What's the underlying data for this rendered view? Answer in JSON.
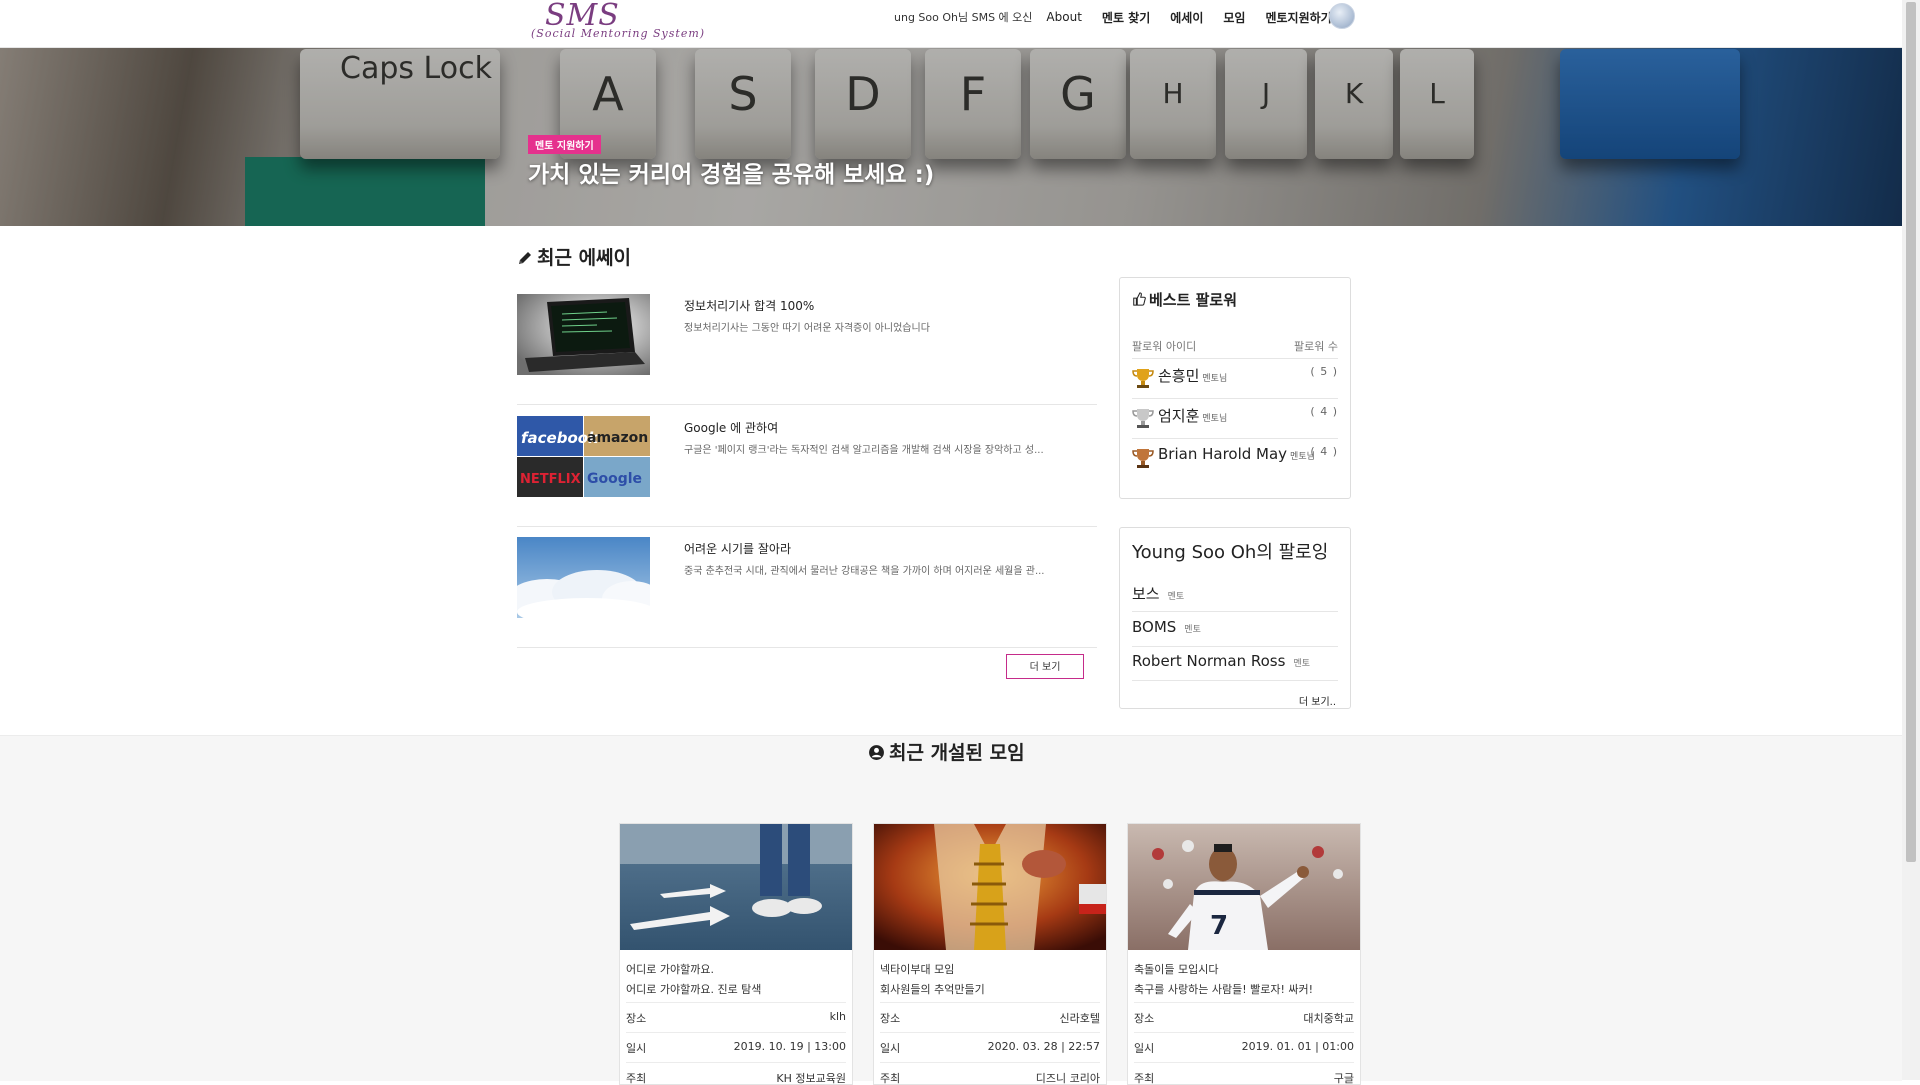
{
  "brand": {
    "name": "SMS",
    "subtitle": "(Social Mentoring System)"
  },
  "nav": {
    "welcome": "ung Soo Oh님 SMS 에 오신",
    "links": [
      "About",
      "멘토 찾기",
      "에세이",
      "모임",
      "멘토지원하기"
    ]
  },
  "hero": {
    "badge": "멘토 지원하기",
    "title": "가치 있는 커리어 경험을 공유해 보세요 :)",
    "keys": [
      "Caps Lock",
      "A",
      "S",
      "D",
      "F",
      "G",
      "H",
      "J",
      "K",
      "L"
    ]
  },
  "essays": {
    "title": "최근 에쎄이",
    "items": [
      {
        "title": "정보처리기사 합격 100%",
        "desc": "정보처리기사는 그동안 따기 어려운 자격증이 아니었습니다"
      },
      {
        "title": "Google 에 관하여",
        "desc": "구글은 '페이지 랭크'라는 독자적인 검색 알고리즘을 개발해 검색 시장을 장악하고 성..."
      },
      {
        "title": "어려운 시기를 잘아라",
        "desc": "중국 춘추전국 시대, 관직에서 물러난 강태공은 책을 가까이 하며 어지러운 세월을 관..."
      }
    ],
    "more": "더 보기",
    "logos": [
      "facebook",
      "amazon",
      "NETFLIX",
      "Google"
    ]
  },
  "best_followers": {
    "title": "베스트 팔로워",
    "col_id": "팔로워 아이디",
    "col_count": "팔로워 수",
    "rows": [
      {
        "name": "손흥민",
        "role": "멘토님",
        "count": "( 5 )",
        "medal": "gold"
      },
      {
        "name": "엄지훈",
        "role": "멘토님",
        "count": "( 4 )",
        "medal": "silver"
      },
      {
        "name": "Brian Harold May",
        "role": "멘토님",
        "count": "( 4 )",
        "medal": "bronze"
      }
    ]
  },
  "following": {
    "title": "Young Soo Oh의 팔로잉",
    "rows": [
      {
        "name": "보스",
        "role": "멘토"
      },
      {
        "name": "BOMS",
        "role": "멘토"
      },
      {
        "name": "Robert Norman Ross",
        "role": "멘토"
      }
    ],
    "more": "더 보기.."
  },
  "groups": {
    "title": "최근 개설된 모임",
    "labels": {
      "place": "장소",
      "date": "일시",
      "host": "주최"
    },
    "items": [
      {
        "name": "어디로 가야할까요.",
        "desc": "어디로 가야할까요. 진로 탐색",
        "place": "klh",
        "date": "2019. 10. 19 | 13:00",
        "host": "KH 정보교육원"
      },
      {
        "name": "넥타이부대 모임",
        "desc": "회사원들의 추억만들기",
        "place": "신라호텔",
        "date": "2020. 03. 28 | 22:57",
        "host": "디즈니 코리아"
      },
      {
        "name": "축돌이들 모입시다",
        "desc": "축구를 사랑하는 사람들! 빨로자! 싸커!",
        "place": "대치중학교",
        "date": "2019. 01. 01 | 01:00",
        "host": "구글"
      }
    ]
  },
  "colors": {
    "brand": "#7a3d80",
    "badge": "#e5318d",
    "more_border": "#c52b8a"
  }
}
